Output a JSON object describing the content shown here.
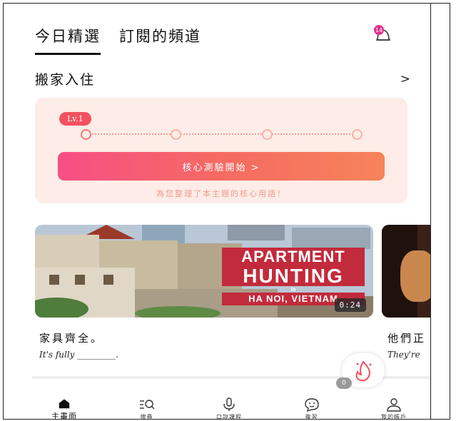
{
  "tabs": [
    "今日精選",
    "訂閱的頻道"
  ],
  "notification": {
    "count": "14"
  },
  "section": {
    "title": "搬家入住",
    "arrow": ">"
  },
  "progress_card": {
    "level_badge": "Lv.1",
    "start_button": "核心測驗開始 >",
    "hint": "為您整理了本主題的核心用語！"
  },
  "video": {
    "title_line1": "APARTMENT",
    "title_line2": "HUNTING",
    "title_in": "in",
    "title_line3": "HA NOI, VIETNAM",
    "duration": "0:24"
  },
  "sentence": {
    "zh": "家具齊全。",
    "en": "It's fully _________."
  },
  "sentence2": {
    "zh": "他們正",
    "en": "They're"
  },
  "floating": {
    "badge": "0"
  },
  "bottom_nav": [
    {
      "label": "主畫面",
      "icon": "home-icon"
    },
    {
      "label": "搜尋",
      "icon": "search-icon"
    },
    {
      "label": "口說課程",
      "icon": "microphone-icon"
    },
    {
      "label": "複習",
      "icon": "review-icon"
    },
    {
      "label": "我的帳戶",
      "icon": "user-icon"
    }
  ],
  "colors": {
    "accent": "#f2515f",
    "card_bg": "#fdece7",
    "badge_gray": "#9a9a9a"
  }
}
